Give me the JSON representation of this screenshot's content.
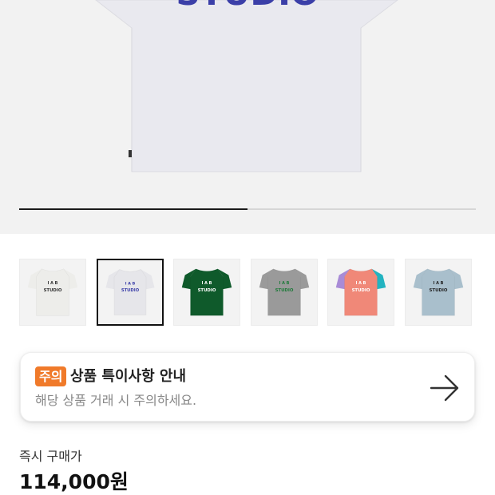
{
  "hero": {
    "image": "white-tshirt-back-print",
    "print_text": "STUDIO",
    "print_color": "#3b3fa8",
    "carousel_progress": 0.5
  },
  "thumbnails": [
    {
      "color_name": "white",
      "body_color": "#ededea",
      "print_color": "#333333",
      "selected": false
    },
    {
      "color_name": "light-gray",
      "body_color": "#e6e6ea",
      "print_color": "#3b3fa8",
      "selected": true
    },
    {
      "color_name": "green",
      "body_color": "#0f5a2b",
      "print_color": "#ffffff",
      "selected": false
    },
    {
      "color_name": "gray",
      "body_color": "#9a9a9a",
      "print_color": "#1f7a3a",
      "selected": false
    },
    {
      "color_name": "coral",
      "body_color": "#f08878",
      "print_color": "#ffffff",
      "sleeve_left": "#a88bd6",
      "sleeve_right": "#22b3c0",
      "selected": false
    },
    {
      "color_name": "light-blue",
      "body_color": "#a9bfcc",
      "print_color": "#222222",
      "selected": false
    }
  ],
  "notice": {
    "badge": "주의",
    "title": "상품 특이사항 안내",
    "description": "해당 상품 거래 시 주의하세요.",
    "badge_color": "#f07a2a",
    "icon": "arrow-right-icon"
  },
  "price": {
    "label": "즉시 구매가",
    "value": "114,000원"
  }
}
